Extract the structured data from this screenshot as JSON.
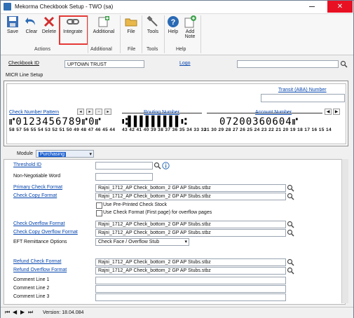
{
  "window": {
    "title": "Mekorma Checkbook Setup  -  TWO (sa)",
    "close_glyph": "✕"
  },
  "ribbon": {
    "buttons": {
      "save": "Save",
      "clear": "Clear",
      "delete": "Delete",
      "integrate": "Integrate",
      "additional": "Additional",
      "file": "File",
      "tools": "Tools",
      "help": "Help",
      "add_note_1": "Add",
      "add_note_2": "Note"
    },
    "groups": {
      "actions": "Actions",
      "additional": "Additional",
      "file": "File",
      "tools": "Tools",
      "help": "Help"
    }
  },
  "header": {
    "checkbook_id_label": "Checkbook ID",
    "checkbook_id_value": "UPTOWN TRUST",
    "logo_label": "Logo",
    "logo_value": ""
  },
  "micr": {
    "section_label": "MICR Line Setup",
    "transit_label": "Transit (ABA) Number",
    "check_number_pattern_label": "Check Number Pattern",
    "routing_number_label": "Routing Number",
    "account_number_label": "Account Number",
    "check_line": "⑈0123456789⑈0⑈",
    "check_nums": "58 57 56 55 54 53 52 51 50 49 48 47 46 45 44",
    "routing_line": "⑆▌▌▌▌▌▌▌▌▌⑆",
    "routing_nums": "43 42 41 40 39 38 37 36 35 34 33 32",
    "account_line": "07200360604⑈",
    "account_nums": "31 30 29 28 27 26 25 24 23 22 21 20 19 18 17 16 15 14"
  },
  "form": {
    "module_label": "Module",
    "module_value": "Purchasing",
    "threshold_id_label": "Threshold ID",
    "threshold_id_value": "",
    "non_negotiable_label": "Non-Negotiable Word",
    "non_negotiable_value": "",
    "primary_check_format_label": "Primary Check Format",
    "primary_check_format_value": "Rajni_1712_AP Check_bottom_2 GP AP Stubs.stbz",
    "check_copy_format_label": "Check Copy Format",
    "check_copy_format_value": "Rajni_1712_AP Check_bottom_2 GP AP Stubs.stbz",
    "use_preprinted_label": "Use Pre-Printed Check Stock",
    "use_check_format_label": "Use Check Format (First page) for overflow pages",
    "check_overflow_format_label": "Check Overflow Format",
    "check_overflow_format_value": "Rajni_1712_AP Check_bottom_2 GP AP Stubs.stbz",
    "check_copy_overflow_label": "Check Copy Overflow Format",
    "check_copy_overflow_value": "Rajni_1712_AP Check_bottom_2 GP AP Stubs.stbz",
    "eft_remittance_label": "EFT Remittance Options",
    "eft_remittance_value": "Check Face / Overflow Stub",
    "refund_check_format_label": "Refund Check Format",
    "refund_check_format_value": "Rajni_1712_AP Check_bottom_2 GP AP Stubs.stbz",
    "refund_overflow_label": "Refund Overflow Format",
    "refund_overflow_value": "Rajni_1712_AP Check_bottom_2 GP AP Stubs.stbz",
    "comment1_label": "Comment Line 1",
    "comment2_label": "Comment Line 2",
    "comment3_label": "Comment Line 3"
  },
  "status": {
    "version": "Version: 18.04.084"
  }
}
